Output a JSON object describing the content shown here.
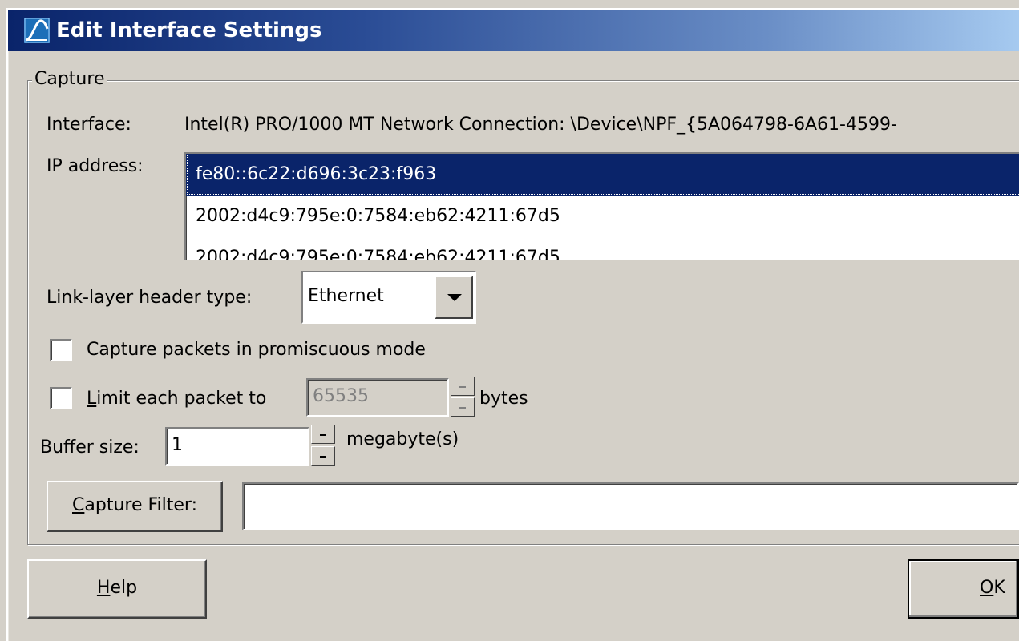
{
  "dialog": {
    "title": "Edit Interface Settings",
    "title_icon": "wireshark-fin-icon"
  },
  "capture_group": {
    "label": "Capture",
    "interface_label": "Interface:",
    "interface_value": "Intel(R) PRO/1000 MT Network Connection: \\Device\\NPF_{5A064798-6A61-4599-",
    "ip_label": "IP address:",
    "ip_addresses": [
      "fe80::6c22:d696:3c23:f963",
      "2002:d4c9:795e:0:7584:eb62:4211:67d5",
      "2002:d4c9:795e:0:7584:eb62:4211:67d5"
    ],
    "ip_selected_index": 0,
    "link_layer_label": "Link-layer header type:",
    "link_layer_value": "Ethernet",
    "promiscuous_label": "Capture packets in promiscuous mode",
    "promiscuous_checked": false,
    "limit_label_prefix": "L",
    "limit_label_rest": "imit each packet to",
    "limit_checked": false,
    "limit_value": "65535",
    "limit_unit": "bytes",
    "buffer_label": "Buffer size:",
    "buffer_value": "1",
    "buffer_unit": "megabyte(s)",
    "filter_button_prefix": "C",
    "filter_button_rest": "apture Filter:",
    "filter_value": ""
  },
  "buttons": {
    "help_prefix": "H",
    "help_rest": "elp",
    "ok_prefix": "O",
    "ok_rest": "K"
  },
  "colors": {
    "face": "#d4d0c8",
    "title_start": "#0a246a",
    "title_end": "#a6caf0",
    "selection": "#0a246a"
  }
}
